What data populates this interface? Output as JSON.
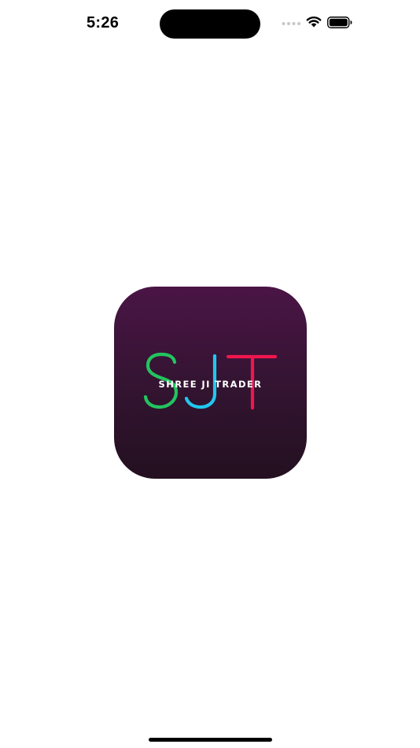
{
  "status_bar": {
    "time": "5:26",
    "icons": [
      "signal-icon",
      "wifi-icon",
      "battery-icon"
    ]
  },
  "splash": {
    "logo_letters": "SJT",
    "logo_caption": "SHREE JI TRADER",
    "colors": {
      "background_top": "#4a1545",
      "background_bottom": "#231020",
      "letter_s": "#22c55e",
      "letter_j": "#22c7ee",
      "letter_t": "#f0164f"
    }
  }
}
